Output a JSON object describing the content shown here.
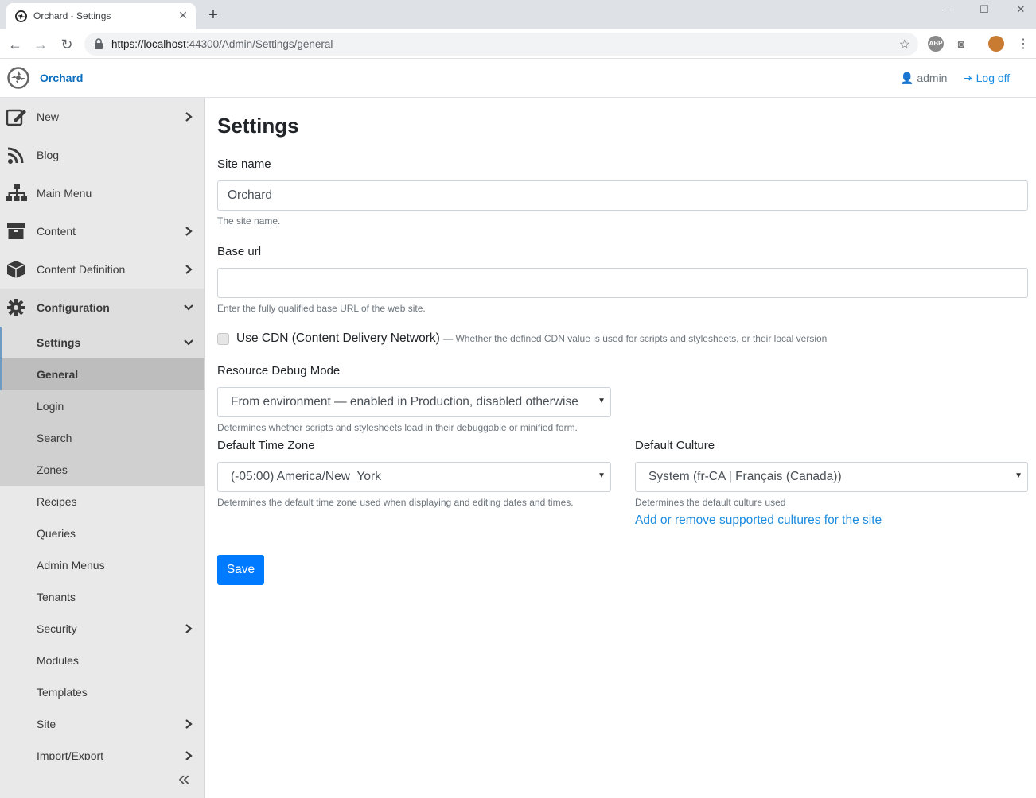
{
  "browser": {
    "tab_title": "Orchard - Settings",
    "new_tab": "+",
    "url_host": "https://localhost",
    "url_path": ":44300/Admin/Settings/general",
    "ext_abp": "ABP"
  },
  "header": {
    "brand": "Orchard",
    "user": "admin",
    "logoff": "Log off"
  },
  "sidebar": {
    "items": [
      {
        "label": "New"
      },
      {
        "label": "Blog"
      },
      {
        "label": "Main Menu"
      },
      {
        "label": "Content"
      },
      {
        "label": "Content Definition"
      },
      {
        "label": "Configuration"
      }
    ],
    "settings": "Settings",
    "sub": [
      "General",
      "Login",
      "Search",
      "Zones",
      "Recipes",
      "Queries",
      "Admin Menus",
      "Tenants",
      "Security",
      "Modules",
      "Templates",
      "Site",
      "Import/Export"
    ],
    "collapse": "«"
  },
  "main": {
    "title": "Settings",
    "site_name_label": "Site name",
    "site_name_value": "Orchard",
    "site_name_help": "The site name.",
    "base_url_label": "Base url",
    "base_url_value": "",
    "base_url_help": "Enter the fully qualified base URL of the web site.",
    "cdn_label": "Use CDN (Content Delivery Network)",
    "cdn_hint": "— Whether the defined CDN value is used for scripts and stylesheets, or their local version",
    "debug_label": "Resource Debug Mode",
    "debug_value": "From environment — enabled in Production, disabled otherwise",
    "debug_help": "Determines whether scripts and stylesheets load in their debuggable or minified form.",
    "tz_label": "Default Time Zone",
    "tz_value": "(-05:00) America/New_York",
    "tz_help": "Determines the default time zone used when displaying and editing dates and times.",
    "culture_label": "Default Culture",
    "culture_value": "System (fr-CA | Français (Canada))",
    "culture_help": "Determines the default culture used",
    "culture_link": "Add or remove supported cultures for the site",
    "save": "Save"
  }
}
